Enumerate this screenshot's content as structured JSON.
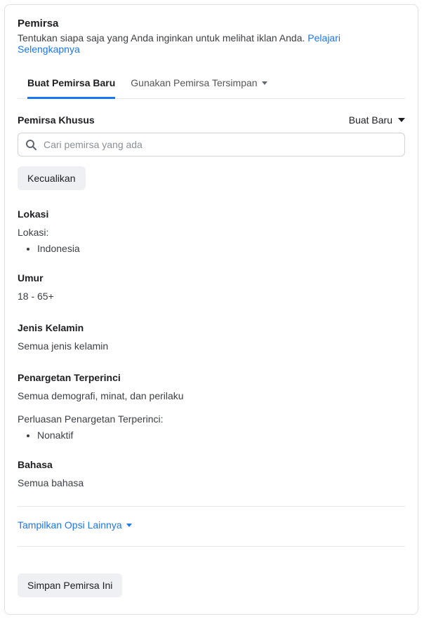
{
  "header": {
    "title": "Pemirsa",
    "description": "Tentukan siapa saja yang Anda inginkan untuk melihat iklan Anda.",
    "learn_more": "Pelajari Selengkapnya"
  },
  "tabs": {
    "create": "Buat Pemirsa Baru",
    "saved": "Gunakan Pemirsa Tersimpan"
  },
  "custom_audience": {
    "label": "Pemirsa Khusus",
    "create_new": "Buat Baru",
    "search_placeholder": "Cari pemirsa yang ada",
    "exclude": "Kecualikan"
  },
  "location": {
    "title": "Lokasi",
    "label": "Lokasi:",
    "items": [
      "Indonesia"
    ]
  },
  "age": {
    "title": "Umur",
    "value": "18 - 65+"
  },
  "gender": {
    "title": "Jenis Kelamin",
    "value": "Semua jenis kelamin"
  },
  "detailed": {
    "title": "Penargetan Terperinci",
    "value": "Semua demografi, minat, dan perilaku",
    "expansion_label": "Perluasan Penargetan Terperinci:",
    "expansion_items": [
      "Nonaktif"
    ]
  },
  "language": {
    "title": "Bahasa",
    "value": "Semua bahasa"
  },
  "more_options": "Tampilkan Opsi Lainnya",
  "save_button": "Simpan Pemirsa Ini"
}
